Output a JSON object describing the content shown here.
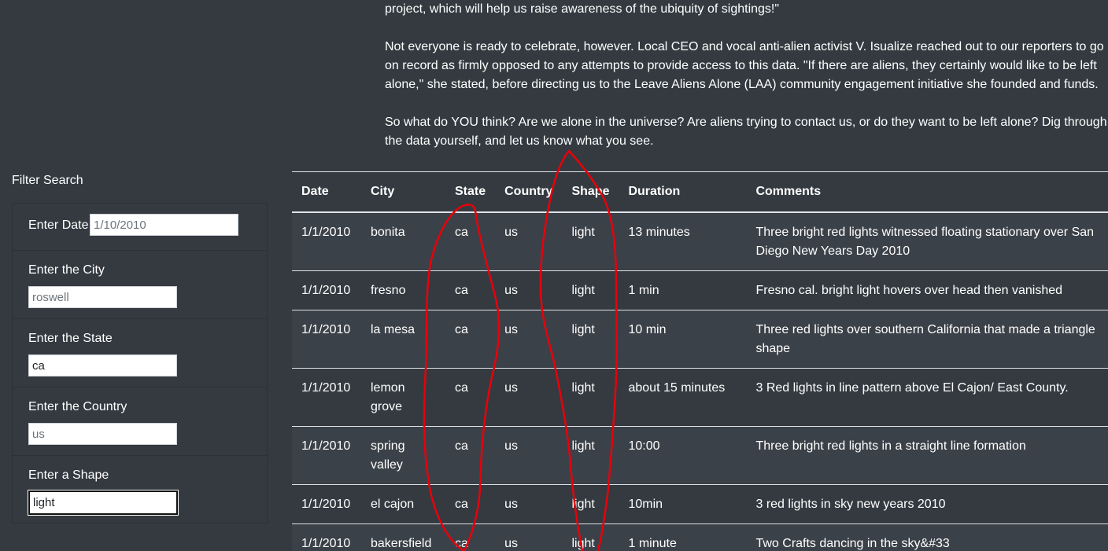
{
  "article": {
    "paragraphs": [
      "us in our search for aliens — and in helping us celebrate the work that has already been done, such as this data visualization project, which will help us raise awareness of the ubiquity of sightings!\"",
      "Not everyone is ready to celebrate, however. Local CEO and vocal anti-alien activist V. Isualize reached out to our reporters to go on record as firmly opposed to any attempts to provide access to this data. \"If there are aliens, they certainly would like to be left alone,\" she stated, before directing us to the Leave Aliens Alone (LAA) community engagement initiative she founded and funds.",
      "So what do YOU think? Are we alone in the universe? Are aliens trying to contact us, or do they want to be left alone? Dig through the data yourself, and let us know what you see."
    ]
  },
  "filters": {
    "title": "Filter Search",
    "date": {
      "label": "Enter Date",
      "placeholder": "1/10/2010",
      "value": ""
    },
    "city": {
      "label": "Enter the City",
      "placeholder": "roswell",
      "value": ""
    },
    "state": {
      "label": "Enter the State",
      "placeholder": "",
      "value": "ca"
    },
    "country": {
      "label": "Enter the Country",
      "placeholder": "us",
      "value": ""
    },
    "shape": {
      "label": "Enter a Shape",
      "placeholder": "",
      "value": "light"
    }
  },
  "table": {
    "headers": [
      "Date",
      "City",
      "State",
      "Country",
      "Shape",
      "Duration",
      "Comments"
    ],
    "rows": [
      [
        "1/1/2010",
        "bonita",
        "ca",
        "us",
        "light",
        "13 minutes",
        "Three bright red lights witnessed floating stationary over San Diego New Years Day 2010"
      ],
      [
        "1/1/2010",
        "fresno",
        "ca",
        "us",
        "light",
        "1 min",
        "Fresno cal. bright light hovers over head then vanished"
      ],
      [
        "1/1/2010",
        "la mesa",
        "ca",
        "us",
        "light",
        "10 min",
        "Three red lights over southern California that made a triangle shape"
      ],
      [
        "1/1/2010",
        "lemon grove",
        "ca",
        "us",
        "light",
        "about 15 minutes",
        "3 Red lights in line pattern above El Cajon/ East County."
      ],
      [
        "1/1/2010",
        "spring valley",
        "ca",
        "us",
        "light",
        "10:00",
        "Three bright red lights in a straight line formation"
      ],
      [
        "1/1/2010",
        "el cajon",
        "ca",
        "us",
        "light",
        "10min",
        "3 red lights in sky new years 2010"
      ],
      [
        "1/1/2010",
        "bakersfield",
        "ca",
        "us",
        "light",
        "1 minute",
        "Two Crafts dancing in the sky&#33"
      ]
    ]
  },
  "colors": {
    "background": "#343a40",
    "row_stripe": "#3b4148",
    "annotation": "#e8000b"
  }
}
